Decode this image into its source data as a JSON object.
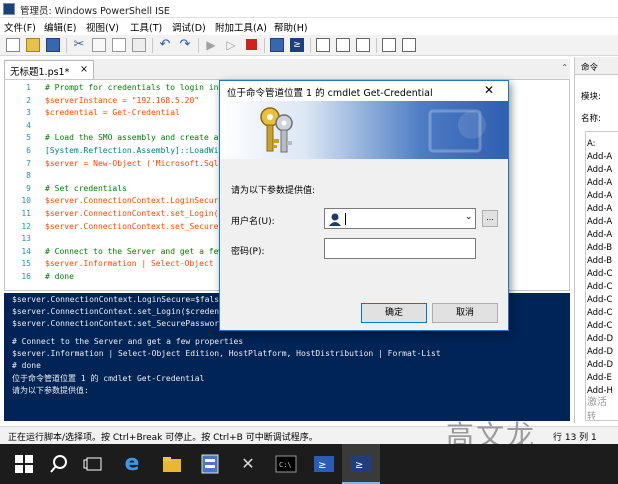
{
  "window": {
    "title": "管理员: Windows PowerShell ISE"
  },
  "menu": [
    "文件(F)",
    "编辑(E)",
    "视图(V)",
    "工具(T)",
    "调试(D)",
    "附加工具(A)",
    "帮助(H)"
  ],
  "editor": {
    "tab_label": "无标题1.ps1*",
    "tab_close": "×",
    "line_numbers": [
      "1",
      "2",
      "3",
      "4",
      "5",
      "6",
      "7",
      "8",
      "9",
      "10",
      "11",
      "12",
      "13",
      "14",
      "15",
      "16"
    ],
    "lines": [
      "# Prompt for credentials to login into",
      "$serverInstance = \"192.168.5.20\"",
      "$credential = Get-Credential",
      "",
      "# Load the SMO assembly and create a S",
      "[System.Reflection.Assembly]::LoadWith",
      "$server = New-Object ('Microsoft.SqlSe",
      "",
      "# Set credentials",
      "$server.ConnectionContext.LoginSecure=",
      "$server.ConnectionContext.set_Login($c",
      "$server.ConnectionContext.set_SecurePa",
      "",
      "# Connect to the Server and get a few",
      "$server.Information | Select-Object Ed",
      "# done"
    ]
  },
  "console": {
    "lines": [
      "$server.ConnectionContext.LoginSecure=$false",
      "$server.ConnectionContext.set_Login($credent",
      "$server.ConnectionContext.set_SecurePassword",
      "",
      "# Connect to the Server and get a few properties",
      "$server.Information | Select-Object Edition, HostPlatform, HostDistribution | Format-List",
      "# done",
      "位于命令管道位置 1 的 cmdlet Get-Credential",
      "请为以下参数提供值:"
    ]
  },
  "command_panel": {
    "header": "命令",
    "module_label": "模块:",
    "name_label": "名称:",
    "items": [
      "A:",
      "Add-A",
      "Add-A",
      "Add-A",
      "Add-A",
      "Add-A",
      "Add-A",
      "Add-A",
      "Add-B",
      "Add-B",
      "Add-C",
      "Add-C",
      "Add-C",
      "Add-C",
      "Add-C",
      "Add-D",
      "Add-D",
      "Add-D",
      "Add-E",
      "Add-H"
    ]
  },
  "status": {
    "text": "正在运行脚本/选择项。按 Ctrl+Break 可停止。按 Ctrl+B 可中断调试程序。",
    "position": "行 13 列 1"
  },
  "dialog": {
    "title": "位于命令管道位置 1 的 cmdlet Get-Credential",
    "close": "✕",
    "prompt": "请为以下参数提供值:",
    "username_label": "用户名(U):",
    "username_value": "",
    "password_label": "密码(P):",
    "password_value": "",
    "browse": "...",
    "ok": "确定",
    "cancel": "取消"
  },
  "overlay": {
    "activate": "激活",
    "goto": "转到\"设",
    "watermark": "高文龙"
  },
  "colors": {
    "console_bg": "#012456",
    "accent": "#1979ca",
    "banner": "#2f5fb0"
  }
}
